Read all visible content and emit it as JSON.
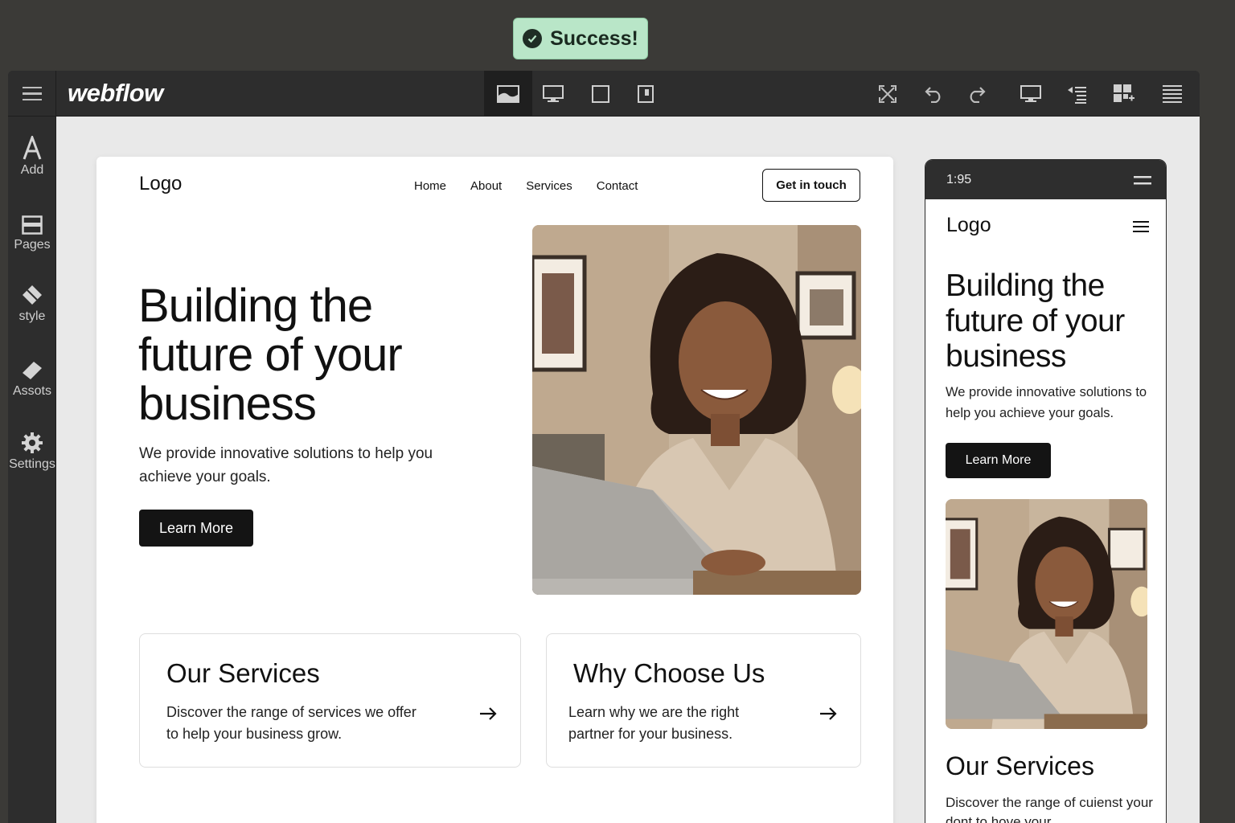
{
  "toast": {
    "text": "Success!"
  },
  "app": {
    "brand": "webflow"
  },
  "sidebar": {
    "items": [
      {
        "label": "Add",
        "icon": "add-icon"
      },
      {
        "label": "Pages",
        "icon": "pages-icon"
      },
      {
        "label": "style",
        "icon": "style-icon"
      },
      {
        "label": "Assots",
        "icon": "assets-icon"
      },
      {
        "label": "Settings",
        "icon": "gear-icon"
      }
    ]
  },
  "toolbar": {
    "icons": [
      "menu-icon",
      "landscape-view-icon",
      "desktop-view-icon",
      "tablet-view-icon",
      "mobile-view-icon",
      "fullscreen-icon",
      "undo-icon",
      "redo-icon",
      "preview-icon",
      "navigator-icon",
      "components-icon",
      "layout-icon"
    ]
  },
  "desktop_preview": {
    "logo": "Logo",
    "nav": [
      "Home",
      "About",
      "Services",
      "Contact"
    ],
    "cta": "Get in touch",
    "hero_title": "Building the future of your business",
    "hero_subtitle": "We provide innovative solutions to help you achieve your goals.",
    "hero_button": "Learn More",
    "cards": [
      {
        "title": "Our Services",
        "text": "Discover the range of services we offer to help your business grow."
      },
      {
        "title": "Why Choose Us",
        "text": "Learn why we are the right partner for your business."
      }
    ]
  },
  "mobile_preview": {
    "time": "1:95",
    "logo": "Logo",
    "hero_title": "Building the future of your business",
    "hero_subtitle": "We provide innovative solutions to help you achieve your goals.",
    "hero_button": "Learn More",
    "section_title": "Our Services",
    "section_text": "Discover the range of cuienst your dont to hove your"
  },
  "colors": {
    "accent_success": "#b9e6c8",
    "button_dark": "#141414",
    "chrome": "#2d2d2d"
  }
}
